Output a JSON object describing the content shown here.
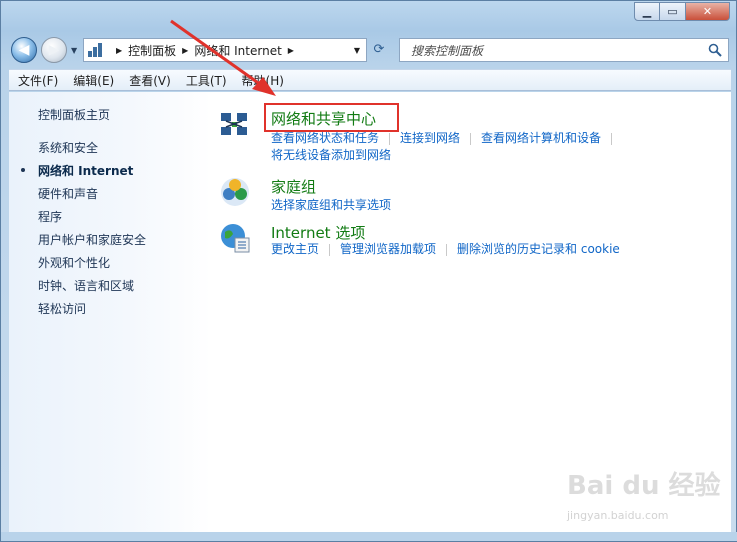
{
  "address": {
    "crumbs": [
      "控制面板",
      "网络和 Internet"
    ]
  },
  "search": {
    "placeholder": "搜索控制面板"
  },
  "menu": [
    "文件(F)",
    "编辑(E)",
    "查看(V)",
    "工具(T)",
    "帮助(H)"
  ],
  "sidebar": {
    "items": [
      {
        "label": "控制面板主页",
        "active": false
      },
      {
        "label": "系统和安全",
        "active": false
      },
      {
        "label": "网络和 Internet",
        "active": true
      },
      {
        "label": "硬件和声音",
        "active": false
      },
      {
        "label": "程序",
        "active": false
      },
      {
        "label": "用户帐户和家庭安全",
        "active": false
      },
      {
        "label": "外观和个性化",
        "active": false
      },
      {
        "label": "时钟、语言和区域",
        "active": false
      },
      {
        "label": "轻松访问",
        "active": false
      }
    ]
  },
  "categories": [
    {
      "title": "网络和共享中心",
      "icon": "network-sharing-icon",
      "links": [
        "查看网络状态和任务",
        "连接到网络",
        "查看网络计算机和设备",
        "将无线设备添加到网络"
      ]
    },
    {
      "title": "家庭组",
      "icon": "homegroup-icon",
      "links": [
        "选择家庭组和共享选项"
      ]
    },
    {
      "title": "Internet 选项",
      "icon": "internet-options-icon",
      "links": [
        "更改主页",
        "管理浏览器加载项",
        "删除浏览的历史记录和 cookie"
      ]
    }
  ],
  "watermark": {
    "logo": "Bai du 经验",
    "url": "jingyan.baidu.com"
  },
  "colors": {
    "link": "#1066c7",
    "category_title": "#127b13",
    "highlight": "#e0322b"
  }
}
